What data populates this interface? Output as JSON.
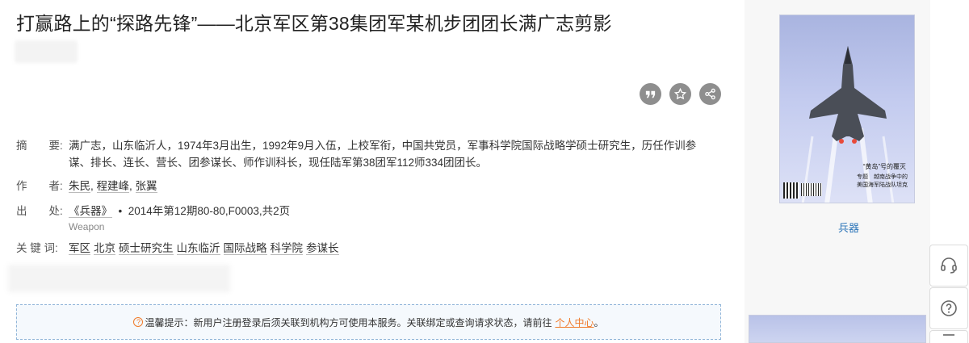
{
  "article": {
    "title": "打赢路上的“探路先锋”——北京军区第38集团军某机步团团长满广志剪影"
  },
  "actions": [
    {
      "name": "cite-icon"
    },
    {
      "name": "favorite-icon"
    },
    {
      "name": "share-icon"
    }
  ],
  "meta": {
    "abstract_label": "摘　　要:",
    "abstract": "满广志，山东临沂人，1974年3月出生，1992年9月入伍，上校军衔，中国共党员，军事科学院国际战略学硕士研究生，历任作训参谋、排长、连长、营长、团参谋长、师作训科长，现任陆军第38团军112师334团团长。",
    "authors_label": "作　　者:",
    "authors": [
      "朱民",
      "程建峰",
      "张翼"
    ],
    "source_label": "出　　处:",
    "journal": "《兵器》",
    "bullet": "•",
    "issue": "2014年第12期80-80,F0003,共2页",
    "journal_en": "Weapon",
    "keywords_label": "关 键 词:",
    "keywords": [
      "军区",
      "北京",
      "硕士研究生",
      "山东临沂",
      "国际战略",
      "科学院",
      "参谋长"
    ]
  },
  "notice": {
    "text": "温馨提示：新用户注册登录后须关联到机构方可使用本服务。关联绑定或查询请求状态，请前往",
    "link": "个人中心",
    "end": "。"
  },
  "sidebar": {
    "journal_name": "兵器",
    "cover_caption_1": "“黄岛”号的覆灭",
    "cover_caption_2": "专题　越南战争中的\n美国海军陆战队坦克"
  }
}
